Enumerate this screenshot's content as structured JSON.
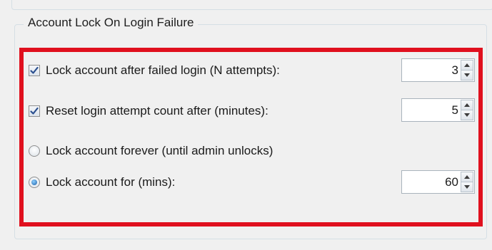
{
  "group": {
    "title": "Account Lock On Login Failure"
  },
  "options": {
    "lock_after_failed": {
      "label": "Lock account after failed login (N attempts):",
      "checked": true,
      "value": "3"
    },
    "reset_count_after": {
      "label": "Reset login attempt count after (minutes):",
      "checked": true,
      "value": "5"
    },
    "lock_forever": {
      "label": "Lock account forever (until admin unlocks)",
      "selected": false
    },
    "lock_for_mins": {
      "label": "Lock account for (mins):",
      "selected": true,
      "value": "60"
    }
  },
  "icons": {
    "check": "checkmark-icon",
    "spin_up": "arrow-up-icon",
    "spin_down": "arrow-down-icon"
  },
  "colors": {
    "highlight": "#e0101e",
    "check_mark": "#2a4f8f",
    "radio_dot": "#1a5fa8",
    "group_border": "#d5dfe5",
    "background": "#f0f0f0"
  }
}
